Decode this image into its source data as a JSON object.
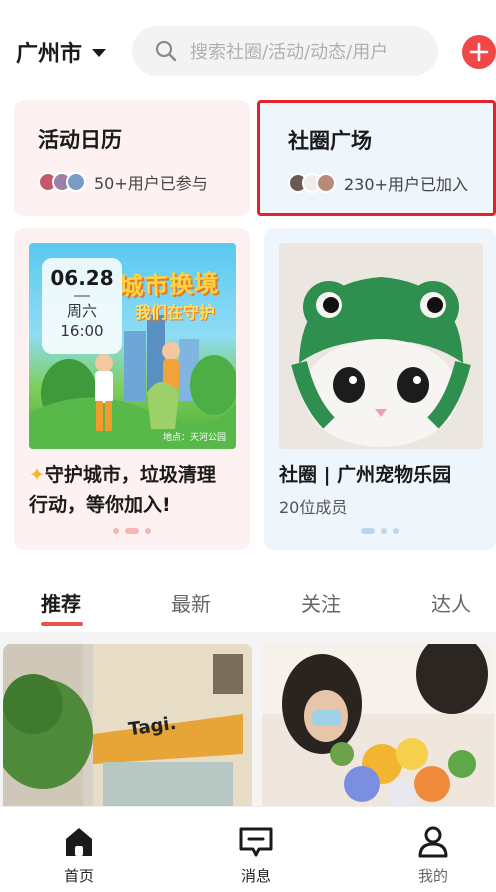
{
  "header": {
    "city": "广州市",
    "search_placeholder": "搜索社圈/活动/动态/用户"
  },
  "quick_cards": [
    {
      "title": "活动日历",
      "meta": "50+用户已参与"
    },
    {
      "title": "社圈广场",
      "meta": "230+用户已加入"
    }
  ],
  "feature_cards": {
    "event": {
      "poster_title": "城市换境",
      "poster_subtitle": "我们在守护",
      "poster_location": "地点：天河公园",
      "date": "06.28",
      "weekday": "周六",
      "time": "16:00",
      "title": "守护城市，垃圾清理行动，等你加入!"
    },
    "circle": {
      "title": "社圈 | 广州宠物乐园",
      "members": "20位成员"
    }
  },
  "tabs": [
    "推荐",
    "最新",
    "关注",
    "达人"
  ],
  "active_tab": "推荐",
  "feed": {
    "shop_sign": "Tagi."
  },
  "bottom_nav": [
    {
      "label": "首页",
      "icon": "home-icon"
    },
    {
      "label": "消息",
      "icon": "message-icon"
    },
    {
      "label": "我的",
      "icon": "profile-icon"
    }
  ],
  "colors": {
    "accent_red": "#e0242a",
    "tab_underline": "#e65450",
    "add_button": "#f04848",
    "card_pink": "#fdf2f1",
    "card_blue": "#eef5fb"
  }
}
